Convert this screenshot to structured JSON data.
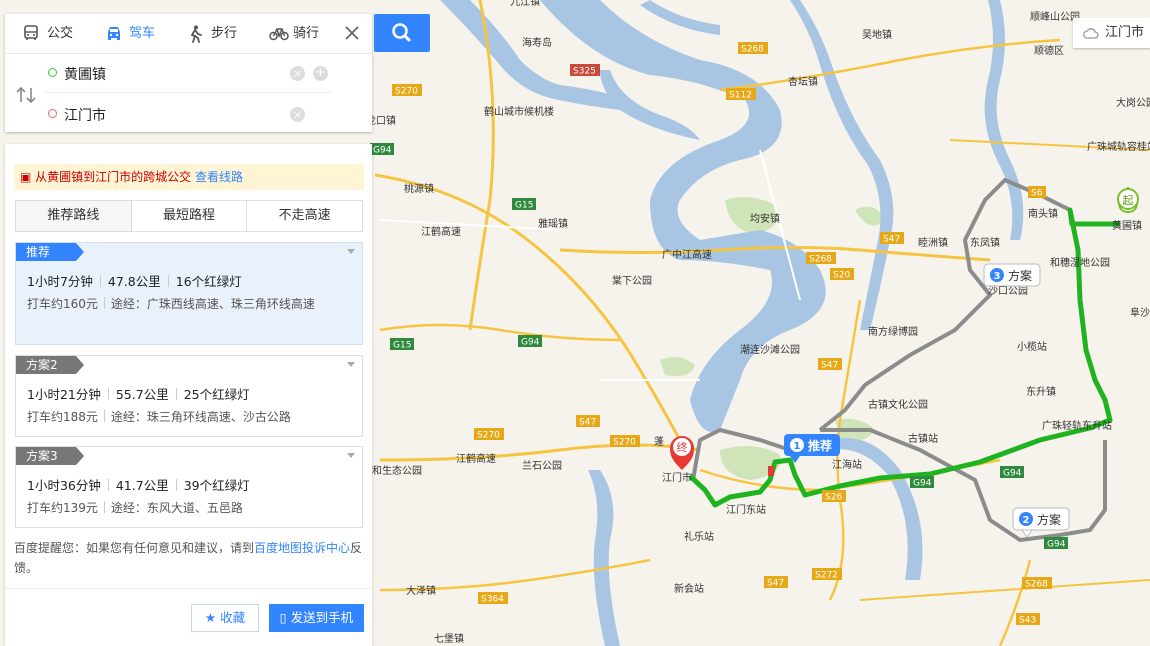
{
  "search": {
    "modes": [
      "公交",
      "驾车",
      "步行",
      "骑行"
    ],
    "active_mode": "驾车",
    "from": "黄圃镇",
    "to": "江门市"
  },
  "notice": {
    "text": "从黄圃镇到江门市的跨城公交",
    "link": "查看线路"
  },
  "route_tabs": [
    "推荐路线",
    "最短路程",
    "不走高速"
  ],
  "routes": [
    {
      "tag": "推荐",
      "time": "1小时7分钟",
      "distance": "47.8公里",
      "lights": "16个红绿灯",
      "taxi": "打车约160元",
      "via_label": "途经：",
      "via": "广珠西线高速、珠三角环线高速"
    },
    {
      "tag": "方案2",
      "time": "1小时21分钟",
      "distance": "55.7公里",
      "lights": "25个红绿灯",
      "taxi": "打车约188元",
      "via_label": "途经：",
      "via": "珠三角环线高速、沙古公路"
    },
    {
      "tag": "方案3",
      "time": "1小时36分钟",
      "distance": "41.7公里",
      "lights": "39个红绿灯",
      "taxi": "打车约139元",
      "via_label": "途经：",
      "via": "东风大道、五邑路"
    }
  ],
  "tip": {
    "before": "百度提醒您：如果您有任何意见和建议，请到",
    "link": "百度地图投诉中心",
    "after": "反馈。"
  },
  "buttons": {
    "favorite": "收藏",
    "send": "发送到手机"
  },
  "city_control": "江门市",
  "map": {
    "labels": {
      "l1": "九江镇",
      "l2": "海寿岛",
      "l3": "鹤山城市候机楼",
      "l4": "龙口镇",
      "l5": "桃源镇",
      "l6": "雅瑶镇",
      "l7": "广中江高速",
      "l8": "均安镇",
      "l9": "棠下公园",
      "l10": "杏坛镇",
      "l11": "吴地镇",
      "l12": "顺德区",
      "l13": "顺峰山公园",
      "l14": "大岗公园",
      "l15": "广珠城轨容桂站",
      "l16": "南头镇",
      "l17": "黄圃镇",
      "l18": "东凤镇",
      "l19": "和穗湿地公园",
      "l20": "沙口公园",
      "l21": "阜沙",
      "l22": "南方绿博园",
      "l23": "潮连沙滩公园",
      "l24": "小榄站",
      "l25": "东升镇",
      "l26": "古镇文化公园",
      "l27": "广珠轻轨东升站",
      "l28": "古镇站",
      "l29": "江海站",
      "l30": "蓬",
      "l31": "江门市",
      "l32": "江门东站",
      "l33": "兰石公园",
      "l34": "江鹤高速",
      "l35": "礼乐站",
      "l36": "新会站",
      "l37": "大泽镇",
      "l38": "七堡镇",
      "l39": "和生态公园",
      "l40": "江鹤高速",
      "l41": "睦洲镇"
    },
    "roads": [
      "S325",
      "S268",
      "S112",
      "S270",
      "G94",
      "G15",
      "S268",
      "S47",
      "S20",
      "S6",
      "S47",
      "G15",
      "G94",
      "S47",
      "S270",
      "G94",
      "S270",
      "G94",
      "S26",
      "S47",
      "S272",
      "S364",
      "S268",
      "S43",
      "G94"
    ],
    "markers": {
      "start": "起",
      "end": "终",
      "plan1_num": "1",
      "plan1": "推荐",
      "plan2_num": "2",
      "plan2": "方案",
      "plan3_num": "3",
      "plan3": "方案"
    }
  }
}
